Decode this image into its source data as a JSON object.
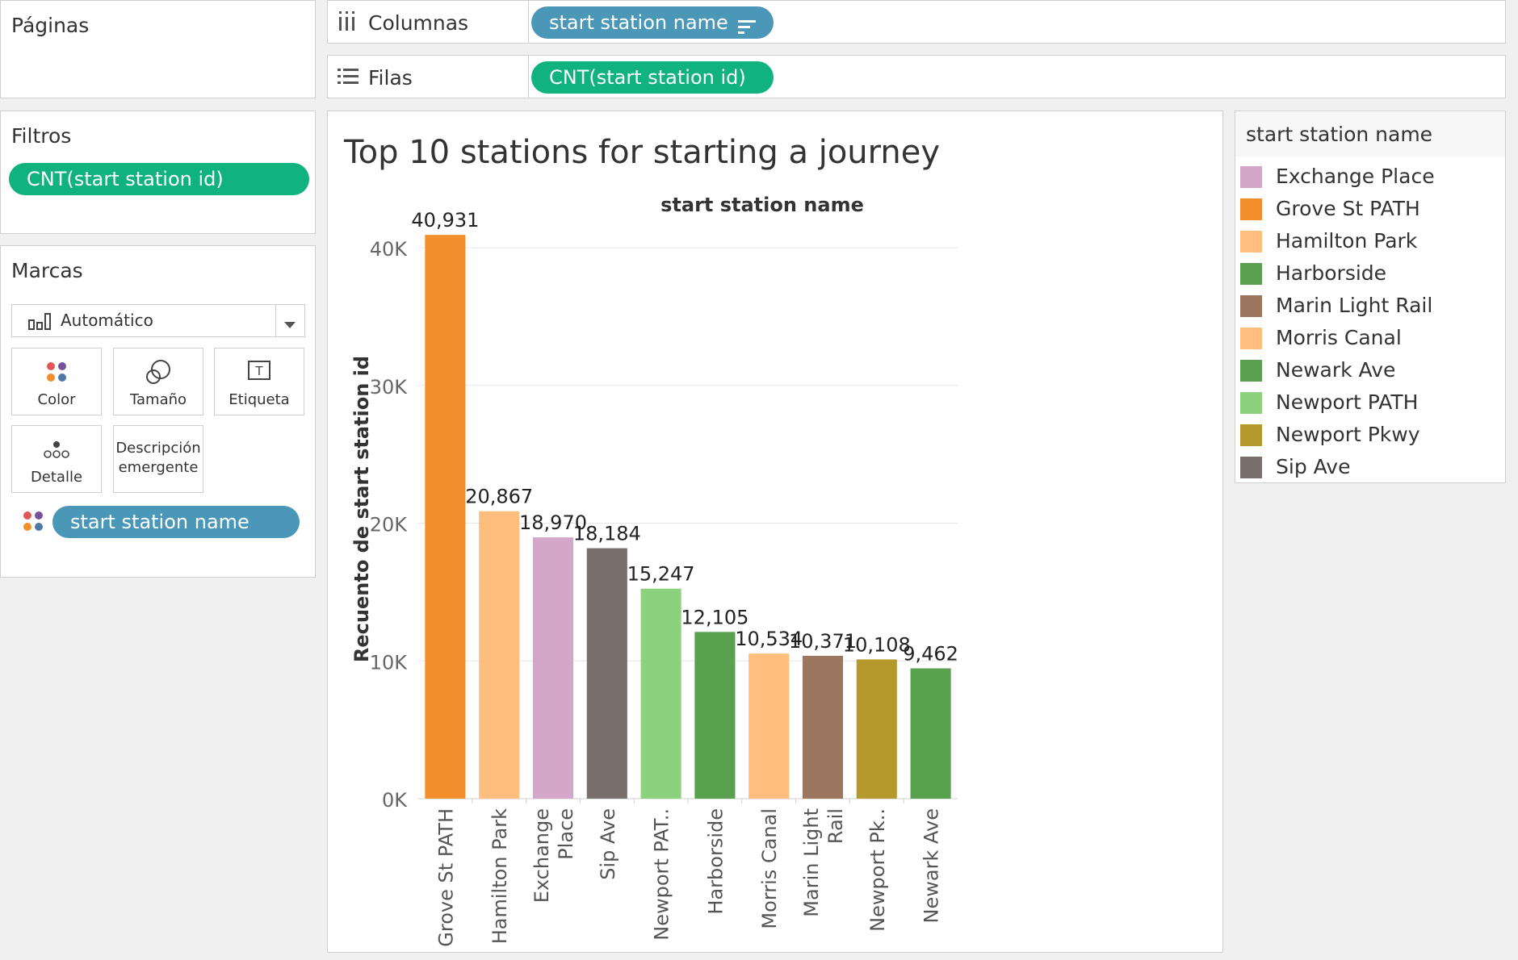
{
  "pages_panel": {
    "title": "Páginas"
  },
  "columns_shelf": {
    "label": "Columnas",
    "pill": "start station name"
  },
  "rows_shelf": {
    "label": "Filas",
    "pill": "CNT(start station id)"
  },
  "filters_panel": {
    "title": "Filtros",
    "pill": "CNT(start station id)"
  },
  "marks_panel": {
    "title": "Marcas",
    "mark_type": "Automático",
    "cards": {
      "color": "Color",
      "size": "Tamaño",
      "label": "Etiqueta",
      "detail": "Detalle",
      "tooltip_line1": "Descripción",
      "tooltip_line2": "emergente"
    },
    "color_pill": "start station name"
  },
  "legend": {
    "title": "start station name",
    "items": [
      {
        "label": "Exchange Place",
        "color": "#d4a6c8"
      },
      {
        "label": "Grove St PATH",
        "color": "#f28e2b"
      },
      {
        "label": "Hamilton Park",
        "color": "#ffbe7d"
      },
      {
        "label": "Harborside",
        "color": "#59a14f"
      },
      {
        "label": "Marin Light Rail",
        "color": "#9d7660"
      },
      {
        "label": "Morris Canal",
        "color": "#ffbe7d"
      },
      {
        "label": "Newark Ave",
        "color": "#59a14f"
      },
      {
        "label": "Newport PATH",
        "color": "#8cd17d"
      },
      {
        "label": "Newport Pkwy",
        "color": "#b6992d"
      },
      {
        "label": "Sip Ave",
        "color": "#79706e"
      }
    ]
  },
  "chart_data": {
    "type": "bar",
    "title": "Top 10 stations for starting a journey",
    "xlabel": "start station name",
    "ylabel": "Recuento de start station id",
    "ylim": [
      0,
      41000
    ],
    "yticks": [
      0,
      10000,
      20000,
      30000,
      40000
    ],
    "ytick_labels": [
      "0K",
      "10K",
      "20K",
      "30K",
      "40K"
    ],
    "grid": true,
    "categories": [
      "Grove St PATH",
      "Hamilton Park",
      "Exchange Place",
      "Sip Ave",
      "Newport PATH",
      "Harborside",
      "Morris Canal",
      "Marin Light Rail",
      "Newport Pkwy",
      "Newark Ave"
    ],
    "category_labels": [
      [
        "Grove St PATH"
      ],
      [
        "Hamilton Park"
      ],
      [
        "Exchange",
        "Place"
      ],
      [
        "Sip Ave"
      ],
      [
        "Newport PAT.."
      ],
      [
        "Harborside"
      ],
      [
        "Morris Canal"
      ],
      [
        "Marin Light",
        "Rail"
      ],
      [
        "Newport Pk.."
      ],
      [
        "Newark Ave"
      ]
    ],
    "values": [
      40931,
      20867,
      18970,
      18184,
      15247,
      12105,
      10534,
      10371,
      10108,
      9462
    ],
    "value_labels": [
      "40,931",
      "20,867",
      "18,970",
      "18,184",
      "15,247",
      "12,105",
      "10,534",
      "10,371",
      "10,108",
      "9,462"
    ],
    "colors": [
      "#f28e2b",
      "#ffbe7d",
      "#d4a6c8",
      "#79706e",
      "#8cd17d",
      "#59a14f",
      "#ffbe7d",
      "#9d7660",
      "#b6992d",
      "#59a14f"
    ]
  }
}
